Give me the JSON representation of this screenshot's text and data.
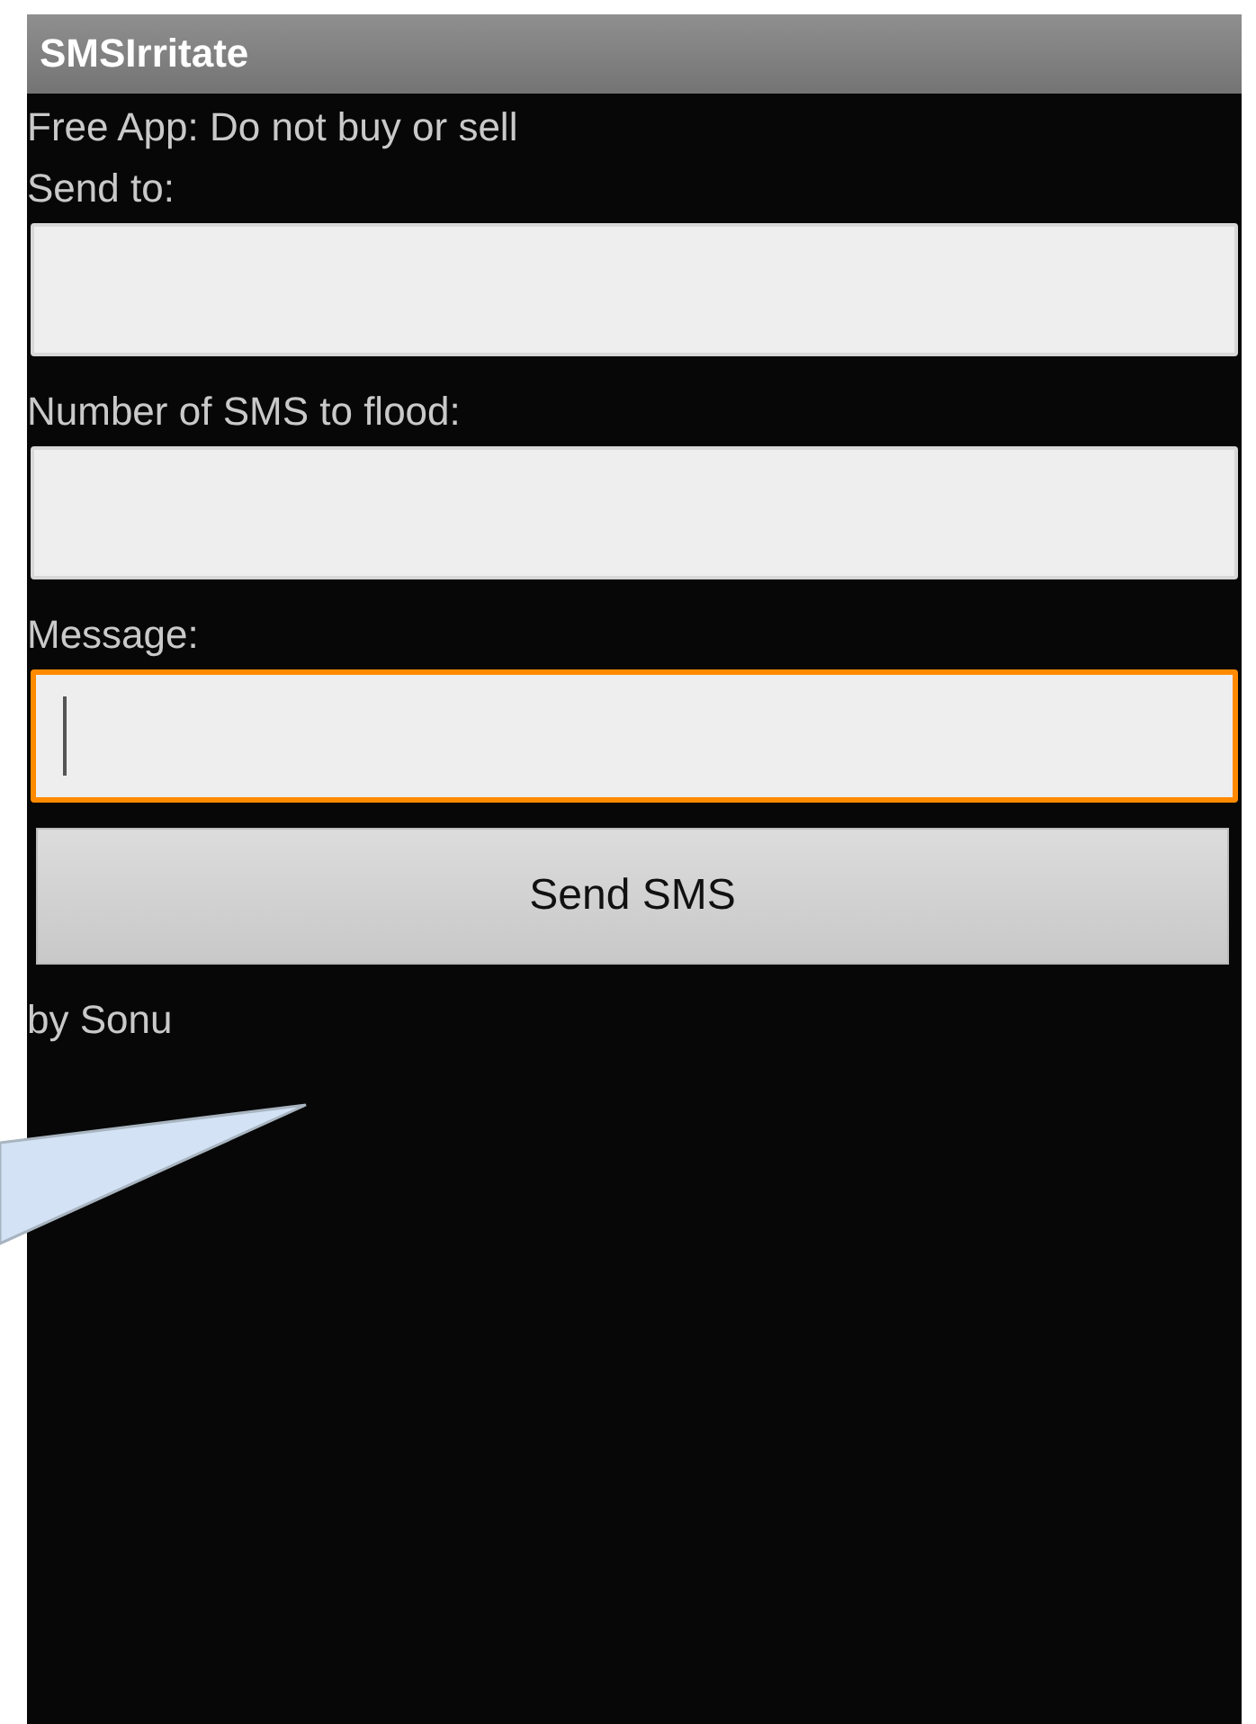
{
  "window": {
    "title": "SMSIrritate"
  },
  "notice": "Free App: Do not buy or sell",
  "fields": [
    {
      "label": "Send to:",
      "focused": false
    },
    {
      "label": "Number of SMS to flood:",
      "focused": false
    },
    {
      "label": "Message:",
      "focused": true
    }
  ],
  "button": "Send SMS",
  "footer": "by Sonu"
}
